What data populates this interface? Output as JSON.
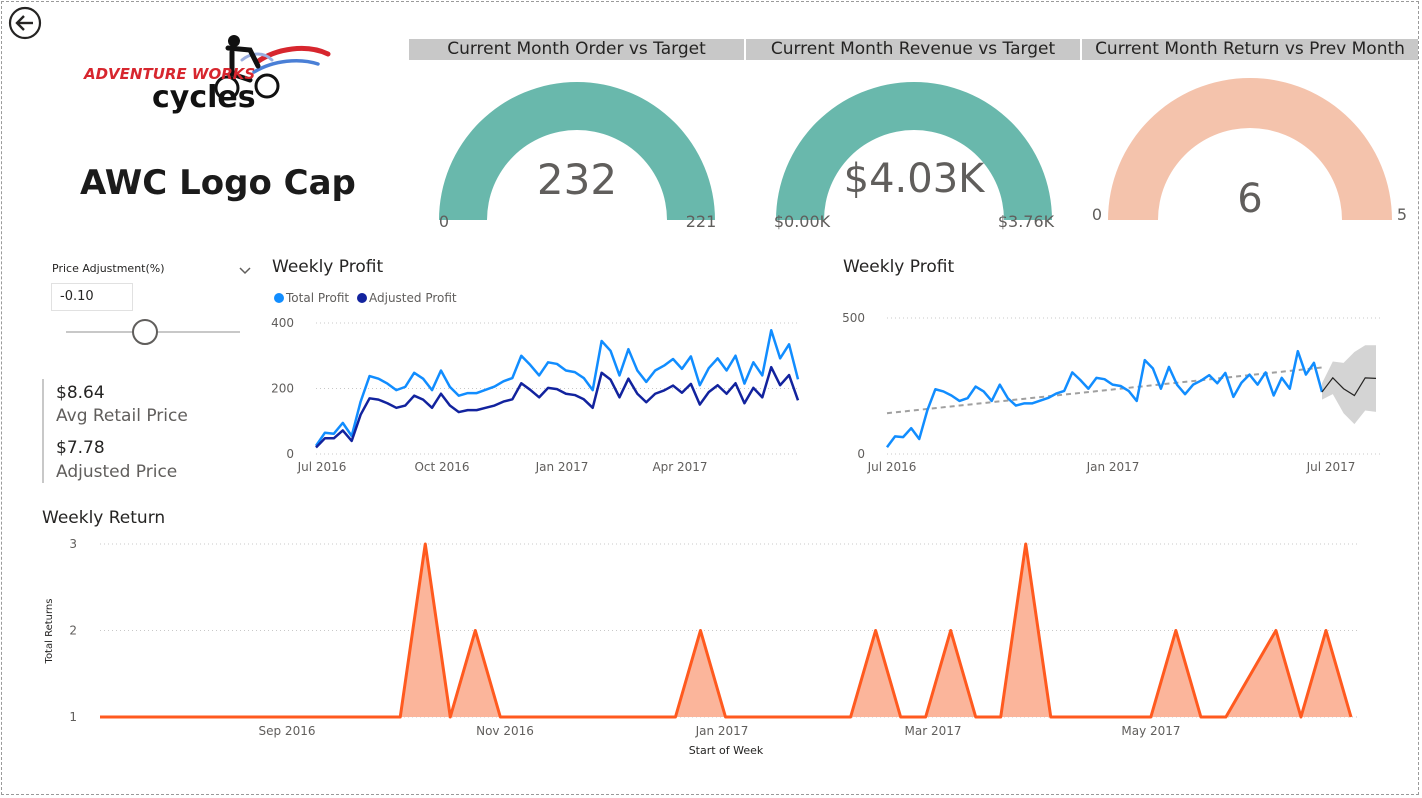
{
  "product": {
    "title": "AWC Logo Cap"
  },
  "logo": {
    "line1": "ADVENTURE WORKS",
    "line2": "cycles"
  },
  "navigation": {
    "back_icon": "back-arrow-icon"
  },
  "gauges": [
    {
      "title": "Current Month Order vs Target",
      "value": 232,
      "value_label": "232",
      "min_label": "0",
      "max_label": "221",
      "min": 0,
      "max": 221,
      "color": "#69B8AC"
    },
    {
      "title": "Current Month Revenue vs Target",
      "value": 4.03,
      "value_label": "$4.03K",
      "min_label": "$0.00K",
      "max_label": "$3.76K",
      "min": 0,
      "max": 3.76,
      "color": "#69B8AC"
    },
    {
      "title": "Current Month Return vs Prev Month",
      "value": 6,
      "value_label": "6",
      "min_label": "0",
      "max_label": "5",
      "min": 0,
      "max": 5,
      "color": "#F4C3AC"
    }
  ],
  "slicer": {
    "title": "Price Adjustment(%)",
    "value": "-0.10",
    "chevron_icon": "chevron-down-icon"
  },
  "kpis": {
    "avg_retail_value": "$8.64",
    "avg_retail_label": "Avg Retail Price",
    "adjusted_value": "$7.78",
    "adjusted_label": "Adjusted Price"
  },
  "colors": {
    "total_profit": "#118DFF",
    "adjusted_profit": "#12239E",
    "returns_line": "#FF5A1F",
    "returns_fill": "#FBB59B",
    "forecast_band": "#D4D4D4",
    "trend": "#A0A0A0"
  },
  "chart_data": [
    {
      "type": "line",
      "title": "Weekly Profit",
      "legend_position": "top-left",
      "x_ticks": [
        "Jul 2016",
        "Oct 2016",
        "Jan 2017",
        "Apr 2017"
      ],
      "y_ticks": [
        0,
        200,
        400
      ],
      "ylim": [
        0,
        400
      ],
      "grid": true,
      "x_start": "2016-07-03",
      "series": [
        {
          "name": "Total Profit",
          "values": [
            25,
            65,
            62,
            95,
            55,
            160,
            238,
            230,
            215,
            195,
            205,
            248,
            230,
            195,
            255,
            205,
            178,
            186,
            186,
            196,
            206,
            222,
            232,
            300,
            272,
            240,
            280,
            275,
            255,
            250,
            232,
            195,
            345,
            315,
            240,
            320,
            255,
            220,
            255,
            270,
            290,
            260,
            298,
            210,
            262,
            292,
            255,
            300,
            215,
            280,
            240,
            378,
            292,
            335,
            228
          ]
        },
        {
          "name": "Adjusted Profit",
          "values": [
            20,
            48,
            48,
            72,
            40,
            120,
            170,
            166,
            155,
            141,
            148,
            178,
            166,
            141,
            184,
            148,
            128,
            134,
            134,
            141,
            148,
            160,
            167,
            216,
            196,
            173,
            202,
            198,
            184,
            180,
            167,
            141,
            248,
            227,
            173,
            230,
            184,
            158,
            184,
            194,
            209,
            187,
            214,
            151,
            189,
            210,
            184,
            216,
            155,
            202,
            173,
            265,
            210,
            241,
            164
          ]
        }
      ]
    },
    {
      "type": "line",
      "title": "Weekly Profit",
      "x_ticks": [
        "Jul 2016",
        "Jan 2017",
        "Jul 2017"
      ],
      "y_ticks": [
        0,
        500
      ],
      "ylim": [
        0,
        500
      ],
      "grid": true,
      "x_start": "2016-07-03",
      "series": [
        {
          "name": "Total Profit",
          "values": [
            25,
            65,
            62,
            95,
            55,
            160,
            238,
            230,
            215,
            195,
            205,
            248,
            230,
            195,
            255,
            205,
            178,
            186,
            186,
            196,
            206,
            222,
            232,
            300,
            272,
            240,
            280,
            275,
            255,
            250,
            232,
            195,
            345,
            315,
            240,
            320,
            255,
            220,
            255,
            270,
            290,
            260,
            298,
            210,
            262,
            292,
            255,
            300,
            215,
            280,
            240,
            378,
            292,
            335,
            228
          ]
        }
      ],
      "trend": {
        "start": 150,
        "end": 318
      },
      "forecast": {
        "values": [
          228,
          280,
          240,
          215,
          280,
          278
        ],
        "upper": [
          260,
          340,
          335,
          375,
          400,
          400
        ],
        "lower": [
          200,
          220,
          150,
          110,
          160,
          155
        ]
      }
    },
    {
      "type": "area",
      "title": "Weekly Return",
      "xlabel": "Start of Week",
      "ylabel": "Total Returns",
      "x_ticks": [
        "Sep 2016",
        "Nov 2016",
        "Jan 2017",
        "Mar 2017",
        "May 2017"
      ],
      "y_ticks": [
        1,
        2,
        3
      ],
      "ylim": [
        1,
        3
      ],
      "grid": true,
      "x_start": "2016-07-03",
      "values": [
        1,
        1,
        1,
        1,
        1,
        1,
        1,
        1,
        1,
        1,
        1,
        1,
        1,
        3,
        1,
        2,
        1,
        1,
        1,
        1,
        1,
        1,
        1,
        1,
        2,
        1,
        1,
        1,
        1,
        1,
        1,
        2,
        1,
        1,
        2,
        1,
        1,
        3,
        1,
        1,
        1,
        1,
        1,
        2,
        1,
        1,
        1.5,
        2,
        1,
        2,
        1
      ]
    }
  ]
}
